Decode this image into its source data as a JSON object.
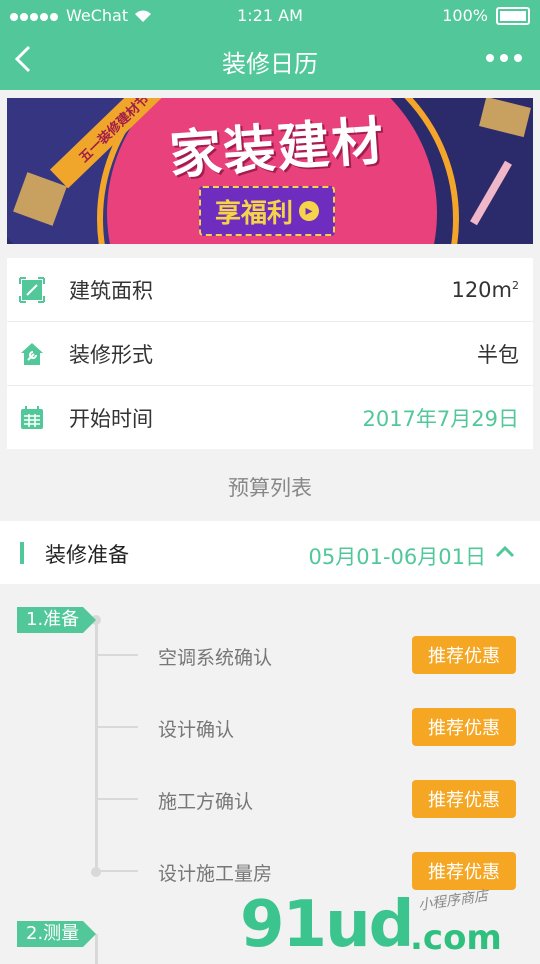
{
  "status": {
    "carrier": "WeChat",
    "time": "1:21 AM",
    "battery": "100%"
  },
  "nav": {
    "title": "装修日历",
    "back_icon": "chevron-left-icon",
    "more_icon": "more-dots-icon"
  },
  "banner": {
    "headline": "家装建材",
    "cta": "享福利",
    "ribbon": "五一装修建材节"
  },
  "info": {
    "area_label": "建筑面积",
    "area_value": "120m",
    "area_unit_sup": "2",
    "type_label": "装修形式",
    "type_value": "半包",
    "start_label": "开始时间",
    "start_value": "2017年7月29日"
  },
  "budget_list": "预算列表",
  "phase": {
    "title": "装修准备",
    "range": "05月01-06月01日"
  },
  "steps": [
    {
      "tag": "1.准备"
    },
    {
      "tag": "2.测量"
    }
  ],
  "items": [
    {
      "text": "空调系统确认",
      "button": "推荐优惠"
    },
    {
      "text": "设计确认",
      "button": "推荐优惠"
    },
    {
      "text": "施工方确认",
      "button": "推荐优惠"
    },
    {
      "text": "设计施工量房",
      "button": "推荐优惠"
    }
  ],
  "watermark": {
    "digits": "91ud",
    "com": ".com",
    "cn": "小程序商店"
  },
  "colors": {
    "brand": "#52c89a",
    "button": "#f5a623"
  }
}
